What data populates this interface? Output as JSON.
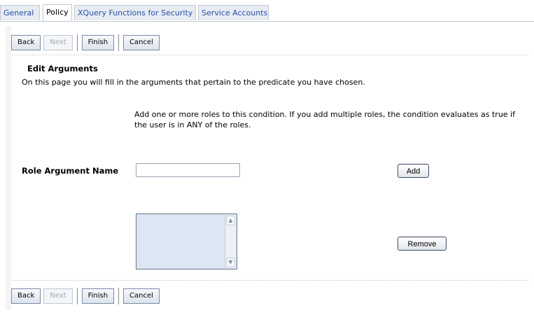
{
  "tabs": [
    {
      "label": "General"
    },
    {
      "label": "Policy"
    },
    {
      "label": "XQuery Functions for Security"
    },
    {
      "label": "Service Accounts"
    }
  ],
  "toolbar": {
    "back": "Back",
    "next": "Next",
    "finish": "Finish",
    "cancel": "Cancel"
  },
  "page": {
    "heading": "Edit Arguments",
    "intro": "On this page you will fill in the arguments that pertain to the predicate you have chosen.",
    "instructions": "Add one or more roles to this condition. If you add multiple roles, the condition evaluates as true if the user is in ANY of the roles."
  },
  "role_argument": {
    "label": "Role Argument Name",
    "value": "",
    "add_label": "Add",
    "remove_label": "Remove",
    "items": []
  },
  "colors": {
    "tab_link": "#2b4fa8",
    "listbox_bg": "#dde6f3"
  }
}
